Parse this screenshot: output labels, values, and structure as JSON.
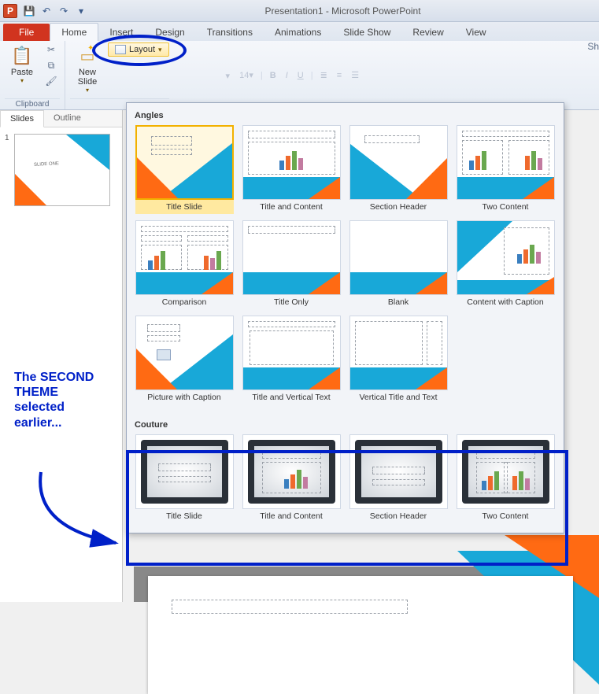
{
  "titlebar": {
    "title": "Presentation1 - Microsoft PowerPoint"
  },
  "tabs": {
    "file": "File",
    "home": "Home",
    "insert": "Insert",
    "design": "Design",
    "transitions": "Transitions",
    "animations": "Animations",
    "slideshow": "Slide Show",
    "review": "Review",
    "view": "View"
  },
  "ribbon": {
    "clipboard": {
      "paste": "Paste",
      "group": "Clipboard"
    },
    "slides": {
      "new_slide": "New Slide",
      "layout": "Layout"
    },
    "font_size": "14",
    "shapes_hint": "Sh"
  },
  "panes": {
    "slides": "Slides",
    "outline": "Outline",
    "slide_number": "1"
  },
  "gallery": {
    "angles_header": "Angles",
    "couture_header": "Couture",
    "angles": [
      "Title Slide",
      "Title and Content",
      "Section Header",
      "Two Content",
      "Comparison",
      "Title Only",
      "Blank",
      "Content with Caption",
      "Picture with Caption",
      "Title and Vertical Text",
      "Vertical Title and Text"
    ],
    "couture": [
      "Title Slide",
      "Title and Content",
      "Section Header",
      "Two Content"
    ]
  },
  "annotation": {
    "text": "The SECOND THEME selected earlier..."
  }
}
